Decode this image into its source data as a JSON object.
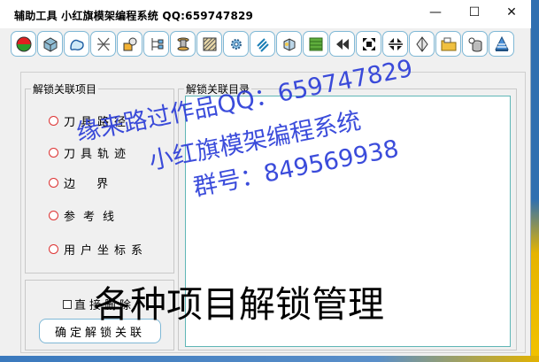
{
  "window": {
    "title": "辅助工具  小红旗模架编程系统  QQ:659747829",
    "minimize_glyph": "—",
    "maximize_glyph": "☐",
    "close_glyph": "✕"
  },
  "toolbar": {
    "buttons": [
      {
        "icon": "color-ball-icon"
      },
      {
        "icon": "solid-box-icon"
      },
      {
        "icon": "curve-shape-icon"
      },
      {
        "icon": "cross-lines-icon"
      },
      {
        "icon": "layer-shapes-icon"
      },
      {
        "icon": "hierarchy-icon"
      },
      {
        "icon": "spool-icon"
      },
      {
        "icon": "hatch-block-icon"
      },
      {
        "icon": "gear-icon"
      },
      {
        "icon": "slant-lines-icon"
      },
      {
        "icon": "view-cube-icon"
      },
      {
        "icon": "green-grid-icon"
      },
      {
        "icon": "rewind-icon"
      },
      {
        "icon": "fullscreen-expand-icon"
      },
      {
        "icon": "fullscreen-collapse-icon"
      },
      {
        "icon": "diamond-tool-icon"
      },
      {
        "icon": "folder-open-icon"
      },
      {
        "icon": "database-icon"
      },
      {
        "icon": "cone-stack-icon"
      }
    ]
  },
  "unlock_items": {
    "title": "解锁关联项目",
    "options": [
      "刀具路径",
      "刀具轨迹",
      "边  界",
      "参考线",
      "用户坐标系"
    ]
  },
  "unlock_list": {
    "title": "解锁关联目录"
  },
  "options": {
    "direct_delete_label": "直接删除"
  },
  "actions": {
    "confirm_label": "确定解锁关联"
  },
  "watermark": {
    "line1": "缘来路过作品QQ：659747829",
    "line2": "小红旗模架编程系统",
    "line3": "群号：849569938"
  },
  "caption": "各种项目解锁管理"
}
